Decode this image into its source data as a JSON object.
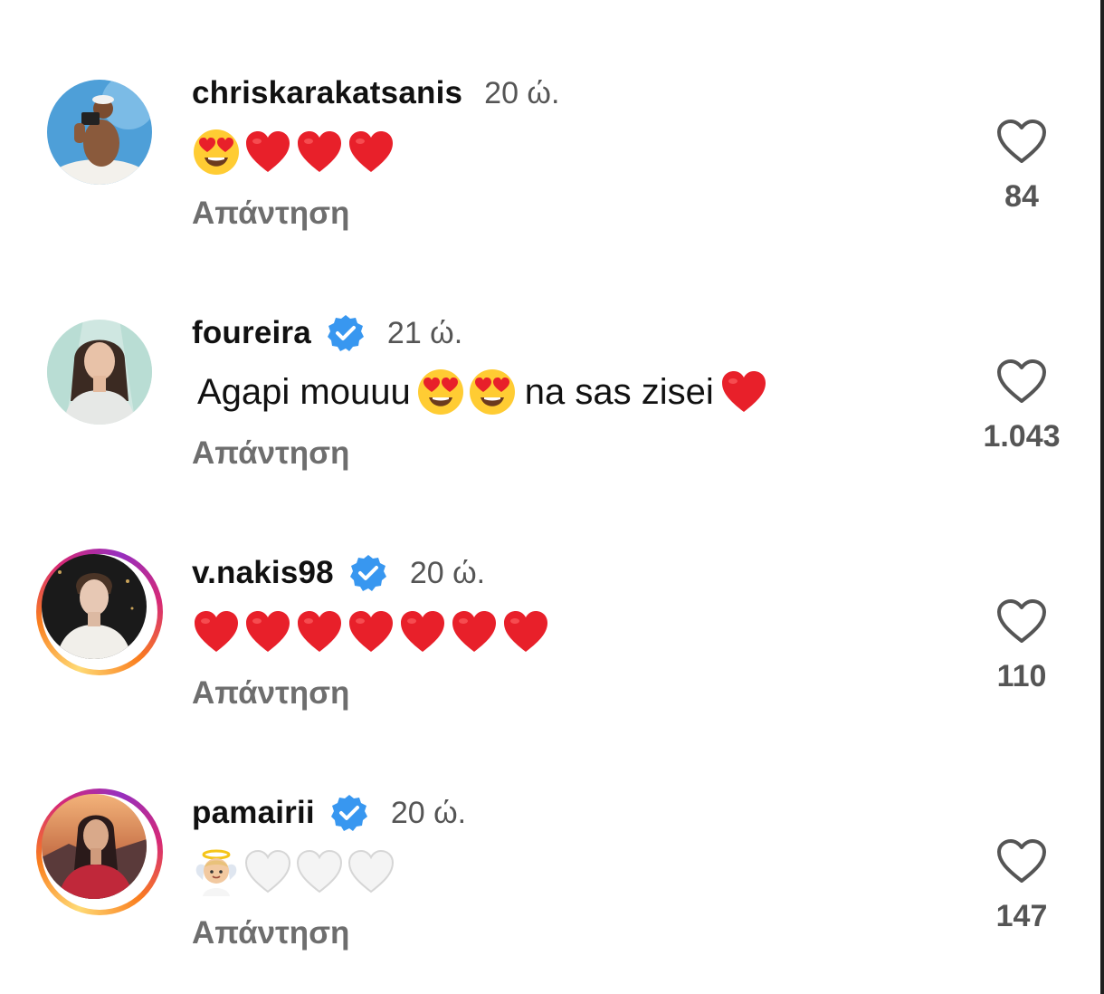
{
  "comments": [
    {
      "username": "chriskarakatsanis",
      "verified": false,
      "time": "20 ώ.",
      "text_parts": [
        {
          "kind": "emoji",
          "name": "heart-eyes-emoji"
        },
        {
          "kind": "emoji",
          "name": "red-heart-emoji"
        },
        {
          "kind": "emoji",
          "name": "red-heart-emoji"
        },
        {
          "kind": "emoji",
          "name": "red-heart-emoji"
        }
      ],
      "reply_label": "Απάντηση",
      "likes": "84",
      "story_ring": false
    },
    {
      "username": "foureira",
      "verified": true,
      "time": "21 ώ.",
      "text_parts": [
        {
          "kind": "text",
          "value": "Agapi mouuu"
        },
        {
          "kind": "emoji",
          "name": "heart-eyes-emoji"
        },
        {
          "kind": "emoji",
          "name": "heart-eyes-emoji"
        },
        {
          "kind": "text",
          "value": "na sas zisei"
        },
        {
          "kind": "emoji",
          "name": "red-heart-emoji"
        }
      ],
      "reply_label": "Απάντηση",
      "likes": "1.043",
      "story_ring": false
    },
    {
      "username": "v.nakis98",
      "verified": true,
      "time": "20 ώ.",
      "text_parts": [
        {
          "kind": "emoji",
          "name": "red-heart-emoji"
        },
        {
          "kind": "emoji",
          "name": "red-heart-emoji"
        },
        {
          "kind": "emoji",
          "name": "red-heart-emoji"
        },
        {
          "kind": "emoji",
          "name": "red-heart-emoji"
        },
        {
          "kind": "emoji",
          "name": "red-heart-emoji"
        },
        {
          "kind": "emoji",
          "name": "red-heart-emoji"
        },
        {
          "kind": "emoji",
          "name": "red-heart-emoji"
        }
      ],
      "reply_label": "Απάντηση",
      "likes": "110",
      "story_ring": true
    },
    {
      "username": "pamairii",
      "verified": true,
      "time": "20 ώ.",
      "text_parts": [
        {
          "kind": "emoji",
          "name": "baby-angel-emoji"
        },
        {
          "kind": "emoji",
          "name": "white-heart-emoji"
        },
        {
          "kind": "emoji",
          "name": "white-heart-emoji"
        },
        {
          "kind": "emoji",
          "name": "white-heart-emoji"
        }
      ],
      "reply_label": "Απάντηση",
      "likes": "147",
      "story_ring": true
    }
  ],
  "colors": {
    "verified_badge": "#3897f0",
    "like_count": "#555555",
    "reply": "#6e6e6e",
    "heart_red": "#e8202a"
  }
}
